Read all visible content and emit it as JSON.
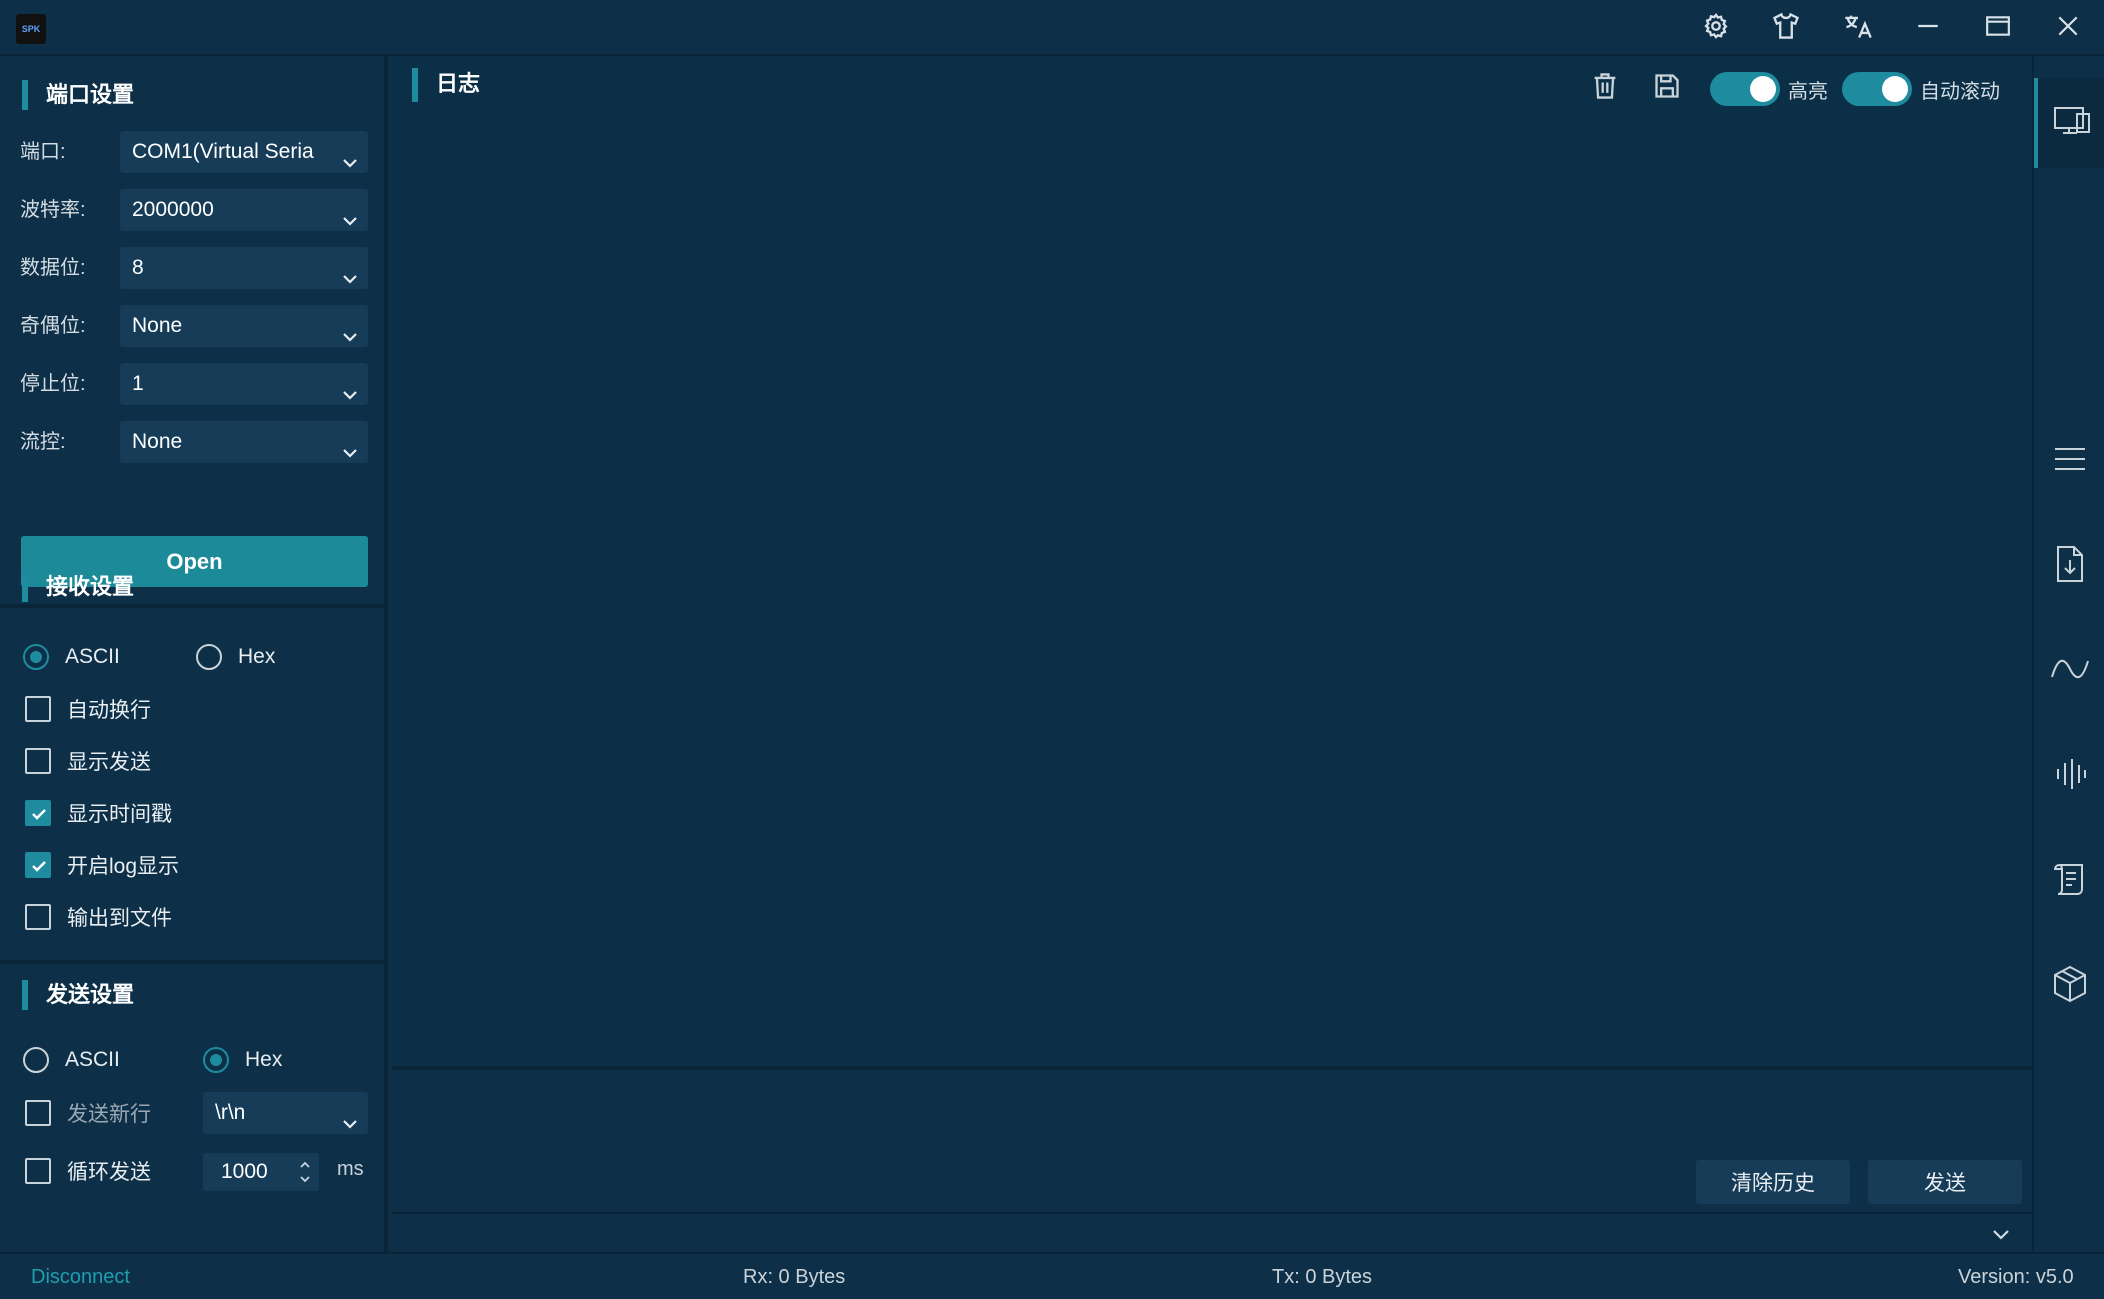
{
  "app": {
    "logo_text": "SPK"
  },
  "titlebar": {
    "icons": [
      "gear-icon",
      "shirt-icon",
      "translate-icon",
      "minimize-icon",
      "maximize-icon",
      "close-icon"
    ]
  },
  "port_settings": {
    "title": "端口设置",
    "fields": [
      {
        "label": "端口:",
        "value": "COM1(Virtual Seria"
      },
      {
        "label": "波特率:",
        "value": "2000000"
      },
      {
        "label": "数据位:",
        "value": "8"
      },
      {
        "label": "奇偶位:",
        "value": "None"
      },
      {
        "label": "停止位:",
        "value": "1"
      },
      {
        "label": "流控:",
        "value": "None"
      }
    ],
    "open_label": "Open"
  },
  "receive_settings": {
    "title": "接收设置",
    "modes": [
      {
        "label": "ASCII",
        "selected": true
      },
      {
        "label": "Hex",
        "selected": false
      }
    ],
    "options": [
      {
        "label": "自动换行",
        "checked": false
      },
      {
        "label": "显示发送",
        "checked": false
      },
      {
        "label": "显示时间戳",
        "checked": true
      },
      {
        "label": "开启log显示",
        "checked": true
      },
      {
        "label": "输出到文件",
        "checked": false
      }
    ]
  },
  "send_settings": {
    "title": "发送设置",
    "modes": [
      {
        "label": "ASCII",
        "selected": false
      },
      {
        "label": "Hex",
        "selected": true
      }
    ],
    "newline": {
      "label": "发送新行",
      "checked": false,
      "value": "\\r\\n"
    },
    "loop": {
      "label": "循环发送",
      "checked": false,
      "interval": "1000",
      "unit": "ms"
    }
  },
  "log": {
    "title": "日志",
    "highlight_label": "高亮",
    "highlight_on": true,
    "autoscroll_label": "自动滚动",
    "autoscroll_on": true
  },
  "send_panel": {
    "clear_history_label": "清除历史",
    "send_label": "发送"
  },
  "right_rail": [
    "devices-icon",
    "menu-icon",
    "file-download-icon",
    "wave-icon",
    "audio-bars-icon",
    "script-icon",
    "box-icon"
  ],
  "status": {
    "connection": "Disconnect",
    "rx": "Rx: 0 Bytes",
    "tx": "Tx: 0 Bytes",
    "version": "Version: v5.0"
  },
  "colors": {
    "background": "#0d2f47",
    "accent": "#1e8c9e",
    "input_bg": "#163c58"
  }
}
